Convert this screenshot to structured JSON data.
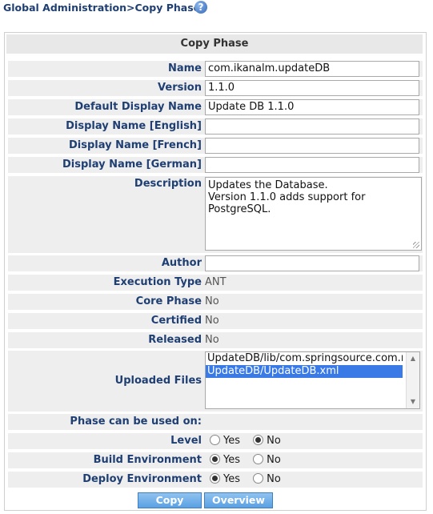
{
  "breadcrumb": "Global Administration>Copy Phase",
  "help_icon": "?",
  "panel": {
    "title": "Copy Phase"
  },
  "fields": {
    "name": {
      "label": "Name",
      "value": "com.ikanalm.updateDB"
    },
    "version": {
      "label": "Version",
      "value": "1.1.0"
    },
    "default_display_name": {
      "label": "Default Display Name",
      "value": "Update DB 1.1.0"
    },
    "display_name_english": {
      "label": "Display Name [English]",
      "value": ""
    },
    "display_name_french": {
      "label": "Display Name [French]",
      "value": ""
    },
    "display_name_german": {
      "label": "Display Name [German]",
      "value": ""
    },
    "description": {
      "label": "Description",
      "lines": [
        "Updates the Database.",
        "Version 1.1.0 adds support for",
        "PostgreSQL."
      ]
    },
    "author": {
      "label": "Author",
      "value": ""
    }
  },
  "info": {
    "execution_type": {
      "label": "Execution Type",
      "value": "ANT"
    },
    "core_phase": {
      "label": "Core Phase",
      "value": "No"
    },
    "certified": {
      "label": "Certified",
      "value": "No"
    },
    "released": {
      "label": "Released",
      "value": "No"
    }
  },
  "uploaded_files": {
    "label": "Uploaded Files",
    "items": [
      "UpdateDB/lib/com.springsource.com.mysql",
      "UpdateDB/UpdateDB.xml"
    ],
    "selected_index": 1
  },
  "usage": {
    "heading": "Phase can be used on:",
    "level": {
      "label": "Level",
      "yes": "Yes",
      "no": "No",
      "selected": "No"
    },
    "build_environment": {
      "label": "Build Environment",
      "yes": "Yes",
      "no": "No",
      "selected": "Yes"
    },
    "deploy_environment": {
      "label": "Deploy Environment",
      "yes": "Yes",
      "no": "No",
      "selected": "Yes"
    }
  },
  "buttons": {
    "copy": "Copy",
    "overview": "Overview"
  }
}
